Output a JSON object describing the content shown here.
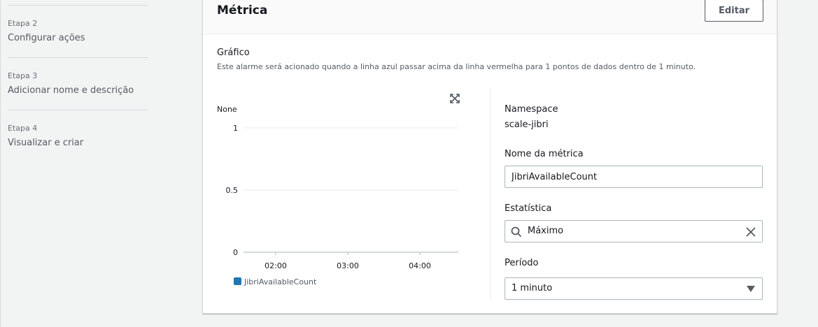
{
  "steps": [
    {
      "number": "Etapa 2",
      "label": "Configurar ações"
    },
    {
      "number": "Etapa 3",
      "label": "Adicionar nome e descrição"
    },
    {
      "number": "Etapa 4",
      "label": "Visualizar e criar"
    }
  ],
  "card": {
    "title": "Métrica",
    "edit_label": "Editar"
  },
  "graph": {
    "title": "Gráfico",
    "description": "Este alarme será acionado quando a linha azul passar acima da linha vermelha para 1 pontos de dados dentro de 1 minuto."
  },
  "chart_data": {
    "type": "line",
    "unit_label": "None",
    "ylim": [
      0,
      1
    ],
    "yticks": [
      "1",
      "0.5",
      "0"
    ],
    "x": [
      "02:00",
      "03:00",
      "04:00"
    ],
    "series": [
      {
        "name": "JibriAvailableCount",
        "values": []
      }
    ],
    "series_color": "#1f77b4",
    "grid": true,
    "legend": "bottom-left"
  },
  "form": {
    "namespace_label": "Namespace",
    "namespace_value": "scale-jibri",
    "metric_name_label": "Nome da métrica",
    "metric_name_value": "JibriAvailableCount",
    "statistic_label": "Estatística",
    "statistic_value": "Máximo",
    "period_label": "Período",
    "period_value": "1 minuto"
  },
  "icons": {
    "expand": "expand-icon",
    "search": "search-icon",
    "clear": "close-icon",
    "dropdown": "caret-down-icon"
  }
}
